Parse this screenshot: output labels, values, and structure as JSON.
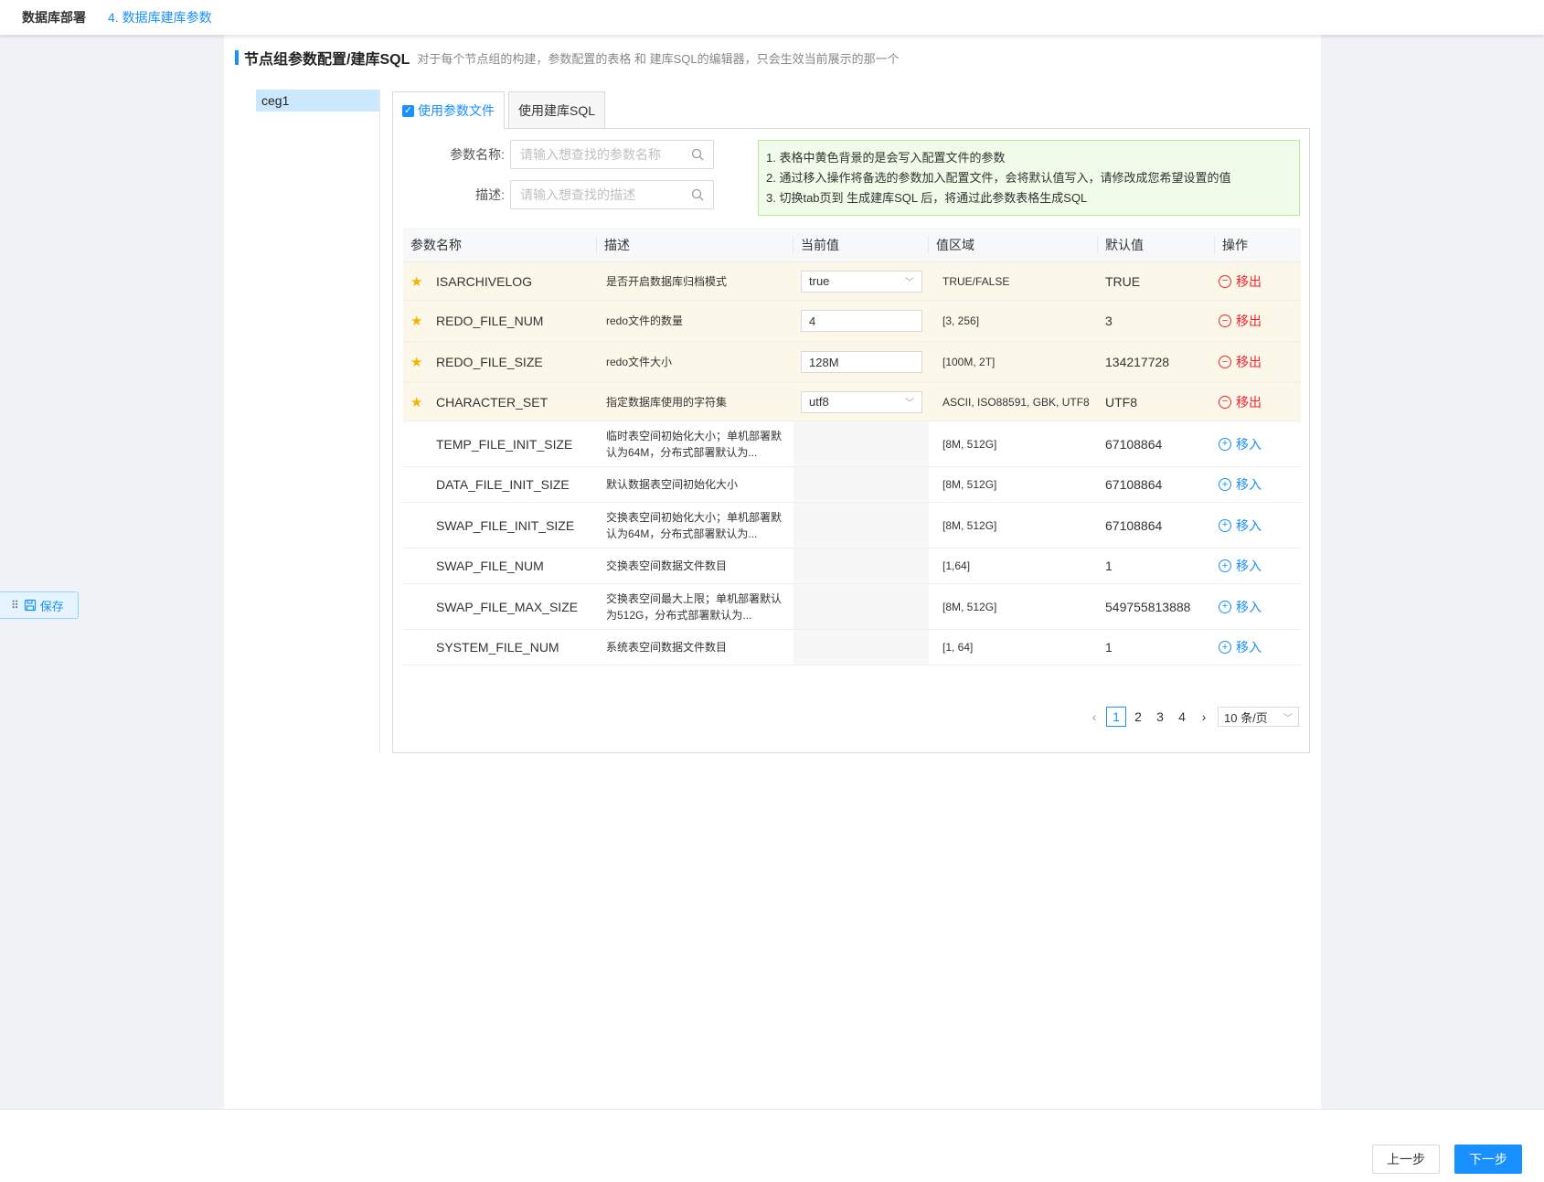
{
  "topbar": {
    "app_title": "数据库部署",
    "breadcrumb": "4. 数据库建库参数"
  },
  "section": {
    "title": "节点组参数配置/建库SQL",
    "subtitle": "对于每个节点组的构建，参数配置的表格 和 建库SQL的编辑器，只会生效当前展示的那一个"
  },
  "node_groups": [
    {
      "label": "ceg1"
    }
  ],
  "tabs": [
    {
      "label": "使用参数文件",
      "checked": true
    },
    {
      "label": "使用建库SQL"
    }
  ],
  "filters": {
    "name_label": "参数名称:",
    "name_placeholder": "请输入想查找的参数名称",
    "desc_label": "描述:",
    "desc_placeholder": "请输入想查找的描述"
  },
  "tips": [
    "1. 表格中黄色背景的是会写入配置文件的参数",
    "2. 通过移入操作将备选的参数加入配置文件，会将默认值写入，请修改成您希望设置的值",
    "3. 切换tab页到 生成建库SQL 后，将通过此参数表格生成SQL"
  ],
  "table": {
    "columns": [
      "参数名称",
      "描述",
      "当前值",
      "值区域",
      "默认值",
      "操作"
    ],
    "rows": [
      {
        "name": "ISARCHIVELOG",
        "desc": "是否开启数据库归档模式",
        "current": "true",
        "current_type": "select",
        "range": "TRUE/FALSE",
        "default": "TRUE",
        "action": "移出",
        "in_config": true
      },
      {
        "name": "REDO_FILE_NUM",
        "desc": "redo文件的数量",
        "current": "4",
        "current_type": "input",
        "range": "[3, 256]",
        "default": "3",
        "action": "移出",
        "in_config": true
      },
      {
        "name": "REDO_FILE_SIZE",
        "desc": "redo文件大小",
        "current": "128M",
        "current_type": "input",
        "range": "[100M, 2T]",
        "default": "134217728",
        "action": "移出",
        "in_config": true
      },
      {
        "name": "CHARACTER_SET",
        "desc": "指定数据库使用的字符集",
        "current": "utf8",
        "current_type": "select",
        "range": "ASCII, ISO88591, GBK, UTF8",
        "default": "UTF8",
        "action": "移出",
        "in_config": true
      },
      {
        "name": "TEMP_FILE_INIT_SIZE",
        "desc": "临时表空间初始化大小；单机部署默认为64M，分布式部署默认为...",
        "current": "",
        "current_type": "none",
        "range": "[8M, 512G]",
        "default": "67108864",
        "action": "移入",
        "in_config": false
      },
      {
        "name": "DATA_FILE_INIT_SIZE",
        "desc": "默认数据表空间初始化大小",
        "current": "",
        "current_type": "none",
        "range": "[8M, 512G]",
        "default": "67108864",
        "action": "移入",
        "in_config": false
      },
      {
        "name": "SWAP_FILE_INIT_SIZE",
        "desc": "交换表空间初始化大小；单机部署默认为64M，分布式部署默认为...",
        "current": "",
        "current_type": "none",
        "range": "[8M, 512G]",
        "default": "67108864",
        "action": "移入",
        "in_config": false
      },
      {
        "name": "SWAP_FILE_NUM",
        "desc": "交换表空间数据文件数目",
        "current": "",
        "current_type": "none",
        "range": "[1,64]",
        "default": "1",
        "action": "移入",
        "in_config": false
      },
      {
        "name": "SWAP_FILE_MAX_SIZE",
        "desc": "交换表空间最大上限；单机部署默认为512G，分布式部署默认为...",
        "current": "",
        "current_type": "none",
        "range": "[8M, 512G]",
        "default": "549755813888",
        "action": "移入",
        "in_config": false
      },
      {
        "name": "SYSTEM_FILE_NUM",
        "desc": "系统表空间数据文件数目",
        "current": "",
        "current_type": "none",
        "range": "[1, 64]",
        "default": "1",
        "action": "移入",
        "in_config": false
      }
    ]
  },
  "pagination": {
    "pages": [
      "1",
      "2",
      "3",
      "4"
    ],
    "current": "1",
    "page_size": "10 条/页"
  },
  "float_save": {
    "label": "保存"
  },
  "footer": {
    "prev": "上一步",
    "next": "下一步"
  },
  "colors": {
    "accent": "#1890ff",
    "danger": "#f5222d",
    "highlight_row": "#fcf8e9",
    "tip_bg": "#f0fbe9"
  },
  "icons": {
    "search": "search-icon",
    "star": "star-icon",
    "remove": "minus-circle-icon",
    "add": "plus-circle-icon",
    "save": "floppy-disk-icon",
    "drag": "drag-handle-icon"
  }
}
